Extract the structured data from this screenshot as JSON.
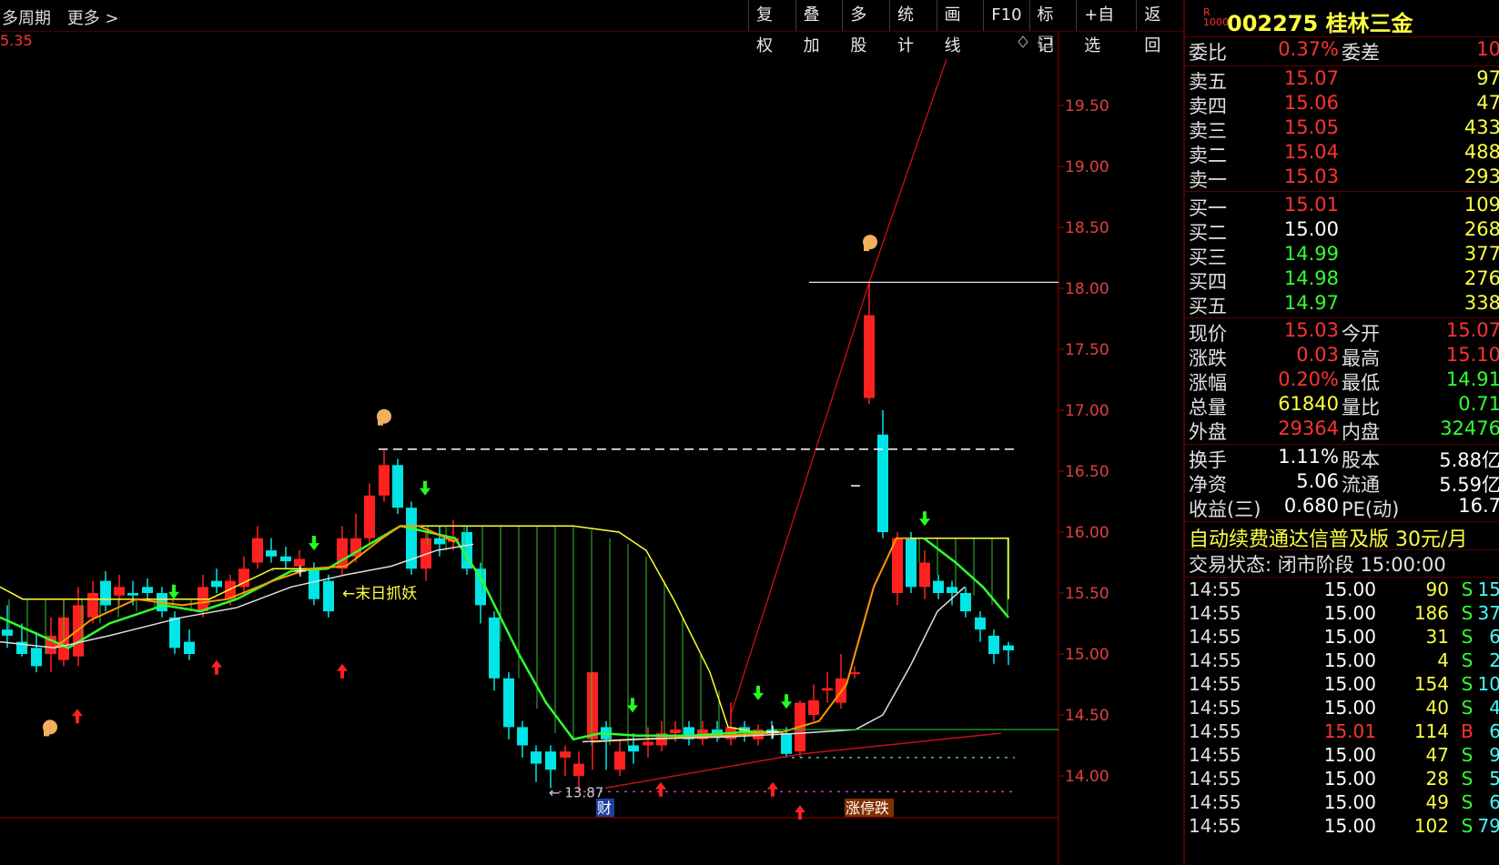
{
  "topbar": {
    "left": [
      "多周期",
      "更多 >"
    ],
    "buttons": [
      "复权",
      "叠加",
      "多股",
      "统计",
      "画线",
      "F10",
      "标记",
      "+自选",
      "返回"
    ]
  },
  "chart": {
    "corner_value": "5.35",
    "y_ticks": [
      "19.50",
      "19.00",
      "18.50",
      "18.00",
      "17.50",
      "17.00",
      "16.50",
      "16.00",
      "15.50",
      "15.00",
      "14.50",
      "14.00"
    ],
    "annotation_label": "←末日抓妖",
    "low_label": "← 13.87",
    "event_labels": [
      "财",
      "涨停跌"
    ],
    "colors": {
      "up": "#ff2020",
      "down": "#00e5e5",
      "grid_axis": "#a00000",
      "ma_white": "#e0e0e0",
      "ma_orange": "#ff9a00",
      "ma_green": "#30ff30",
      "ma_yellow": "#ffff30"
    }
  },
  "panel": {
    "badge_top": "R",
    "badge_bottom": "1000",
    "code": "002275",
    "name": "桂林三金",
    "weibi": {
      "label": "委比",
      "value": "0.37%",
      "label2": "委差",
      "value2": "10"
    },
    "sells": [
      {
        "label": "卖五",
        "price": "15.07",
        "vol": "97"
      },
      {
        "label": "卖四",
        "price": "15.06",
        "vol": "47"
      },
      {
        "label": "卖三",
        "price": "15.05",
        "vol": "433"
      },
      {
        "label": "卖二",
        "price": "15.04",
        "vol": "488"
      },
      {
        "label": "卖一",
        "price": "15.03",
        "vol": "293"
      }
    ],
    "buys": [
      {
        "label": "买一",
        "price": "15.01",
        "vol": "109",
        "pc": "red"
      },
      {
        "label": "买二",
        "price": "15.00",
        "vol": "268",
        "pc": "white"
      },
      {
        "label": "买三",
        "price": "14.99",
        "vol": "377",
        "pc": "green"
      },
      {
        "label": "买四",
        "price": "14.98",
        "vol": "276",
        "pc": "green"
      },
      {
        "label": "买五",
        "price": "14.97",
        "vol": "338",
        "pc": "green"
      }
    ],
    "stats1": [
      {
        "l1": "现价",
        "v1": "15.03",
        "c1": "red",
        "l2": "今开",
        "v2": "15.07",
        "c2": "red"
      },
      {
        "l1": "涨跌",
        "v1": "0.03",
        "c1": "red",
        "l2": "最高",
        "v2": "15.10",
        "c2": "red"
      },
      {
        "l1": "涨幅",
        "v1": "0.20%",
        "c1": "red",
        "l2": "最低",
        "v2": "14.91",
        "c2": "green"
      },
      {
        "l1": "总量",
        "v1": "61840",
        "c1": "yellow",
        "l2": "量比",
        "v2": "0.71",
        "c2": "green"
      },
      {
        "l1": "外盘",
        "v1": "29364",
        "c1": "red",
        "l2": "内盘",
        "v2": "32476",
        "c2": "green"
      }
    ],
    "stats2": [
      {
        "l1": "换手",
        "v1": "1.11%",
        "c1": "white",
        "l2": "股本",
        "v2": "5.88亿",
        "c2": "white"
      },
      {
        "l1": "净资",
        "v1": "5.06",
        "c1": "white",
        "l2": "流通",
        "v2": "5.59亿",
        "c2": "white"
      },
      {
        "l1": "收益(三)",
        "v1": "0.680",
        "c1": "white",
        "l2": "PE(动)",
        "v2": "16.7",
        "c2": "white"
      }
    ],
    "ad": "自动续费通达信普及版 30元/月",
    "status": "交易状态: 闭市阶段 15:00:00",
    "ticks": [
      {
        "t": "14:55",
        "p": "15.00",
        "pc": "white",
        "v": "90",
        "d": "S",
        "n": "15"
      },
      {
        "t": "14:55",
        "p": "15.00",
        "pc": "white",
        "v": "186",
        "d": "S",
        "n": "37"
      },
      {
        "t": "14:55",
        "p": "15.00",
        "pc": "white",
        "v": "31",
        "d": "S",
        "n": "6"
      },
      {
        "t": "14:55",
        "p": "15.00",
        "pc": "white",
        "v": "4",
        "d": "S",
        "n": "2"
      },
      {
        "t": "14:55",
        "p": "15.00",
        "pc": "white",
        "v": "154",
        "d": "S",
        "n": "10"
      },
      {
        "t": "14:55",
        "p": "15.00",
        "pc": "white",
        "v": "40",
        "d": "S",
        "n": "4"
      },
      {
        "t": "14:55",
        "p": "15.01",
        "pc": "red",
        "v": "114",
        "d": "B",
        "n": "6"
      },
      {
        "t": "14:55",
        "p": "15.00",
        "pc": "white",
        "v": "47",
        "d": "S",
        "n": "9"
      },
      {
        "t": "14:55",
        "p": "15.00",
        "pc": "white",
        "v": "28",
        "d": "S",
        "n": "5"
      },
      {
        "t": "14:55",
        "p": "15.00",
        "pc": "white",
        "v": "49",
        "d": "S",
        "n": "6"
      },
      {
        "t": "14:55",
        "p": "15.00",
        "pc": "white",
        "v": "102",
        "d": "S",
        "n": "79"
      }
    ]
  }
}
